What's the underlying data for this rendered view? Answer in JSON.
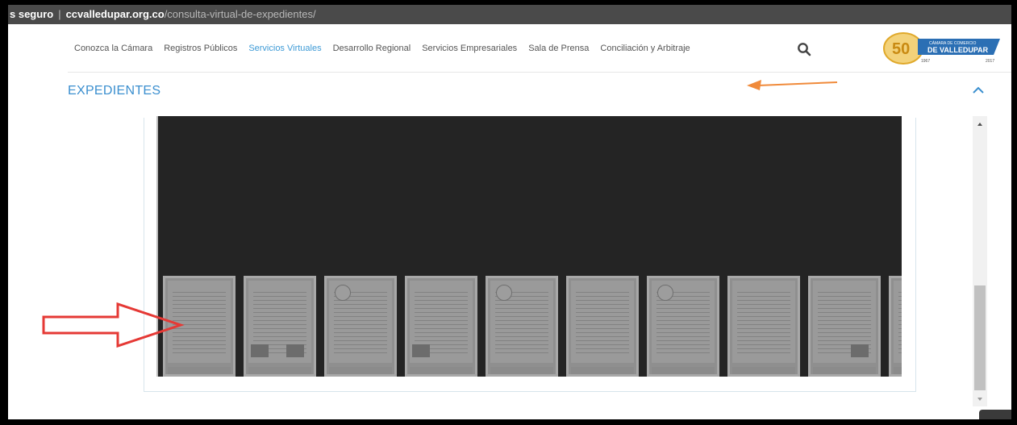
{
  "browser": {
    "security_label": "s seguro",
    "host": "ccvalledupar.org.co",
    "path": "/consulta-virtual-de-expedientes/"
  },
  "nav": {
    "items": [
      {
        "label": "Conozca la Cámara",
        "active": false
      },
      {
        "label": "Registros Públicos",
        "active": false
      },
      {
        "label": "Servicios Virtuales",
        "active": true
      },
      {
        "label": "Desarrollo Regional",
        "active": false
      },
      {
        "label": "Servicios Empresariales",
        "active": false
      },
      {
        "label": "Sala de Prensa",
        "active": false
      },
      {
        "label": "Conciliación y Arbitraje",
        "active": false
      }
    ],
    "search_icon": "search-icon"
  },
  "logo": {
    "number": "50",
    "line1": "CÁMARA DE COMERCIO",
    "line2": "DE VALLEDUPAR",
    "year_start": "1967",
    "year_end": "2017"
  },
  "section": {
    "title": "EXPEDIENTES",
    "collapse_icon": "chevron-up-icon"
  },
  "viewer": {
    "thumbnail_count": 10
  },
  "colors": {
    "accent": "#3d9ad6",
    "annotation_orange": "#f08a3a",
    "annotation_red": "#e53935",
    "viewer_bg": "#242424"
  }
}
